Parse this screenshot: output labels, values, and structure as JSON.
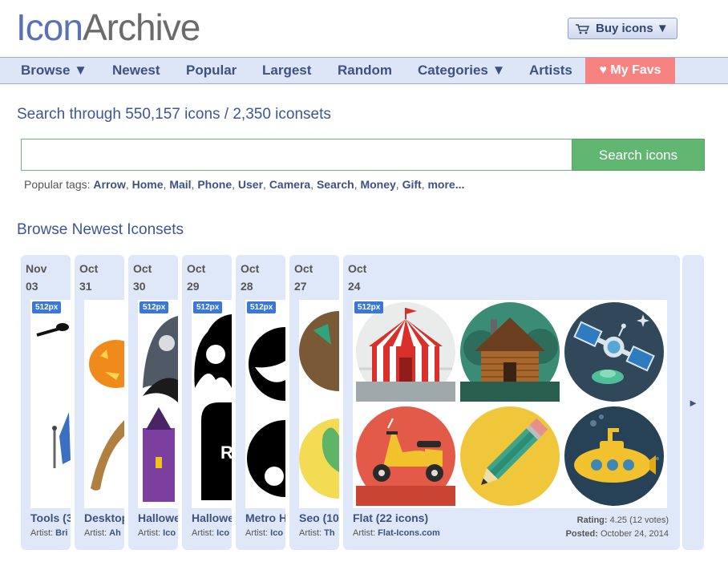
{
  "header": {
    "logo_part1": "Icon",
    "logo_part2": "Archive",
    "buy_label": "Buy icons ▼"
  },
  "nav": {
    "items": [
      "Browse ▼",
      "Newest",
      "Popular",
      "Largest",
      "Random",
      "Categories ▼",
      "Artists"
    ],
    "favs_label": "♥ My Favs"
  },
  "search": {
    "title": "Search through 550,157 icons / 2,350 iconsets",
    "button_label": "Search icons",
    "input_value": "",
    "tags_prefix": "Popular tags: ",
    "tags": [
      "Arrow",
      "Home",
      "Mail",
      "Phone",
      "User",
      "Camera",
      "Search",
      "Money",
      "Gift",
      "more..."
    ]
  },
  "browse": {
    "title": "Browse Newest Iconsets",
    "cards": [
      {
        "month": "Nov",
        "day": "03",
        "name": "Tools (3",
        "artist_label": "Artist: ",
        "artist": "Bri",
        "badge": "512px"
      },
      {
        "month": "Oct",
        "day": "31",
        "name": "Desktop",
        "artist_label": "Artist: ",
        "artist": "Ah",
        "badge": ""
      },
      {
        "month": "Oct",
        "day": "30",
        "name": "Hallowe",
        "artist_label": "Artist: ",
        "artist": "Ico",
        "badge": "512px"
      },
      {
        "month": "Oct",
        "day": "29",
        "name": "Hallowe",
        "artist_label": "Artist: ",
        "artist": "Ico",
        "badge": "512px"
      },
      {
        "month": "Oct",
        "day": "28",
        "name": "Metro H",
        "artist_label": "Artist: ",
        "artist": "Ico",
        "badge": "512px"
      },
      {
        "month": "Oct",
        "day": "27",
        "name": "Seo (10",
        "artist_label": "Artist: ",
        "artist": "Th",
        "badge": ""
      },
      {
        "month": "Oct",
        "day": "24",
        "name": "Flat (22 icons)",
        "artist_label": "Artist: ",
        "artist": "Flat-Icons.com",
        "badge": "512px",
        "rating_label": "Rating: ",
        "rating": "4.25 (12 votes)",
        "posted_label": "Posted: ",
        "posted": "October 24, 2014"
      }
    ],
    "next_label": "►"
  },
  "colors": {
    "accent": "#3e5183",
    "nav_bg": "#dde6f7",
    "favs_bg": "#f78282",
    "search_btn": "#61b672",
    "card_bg": "#dfe8f8"
  }
}
